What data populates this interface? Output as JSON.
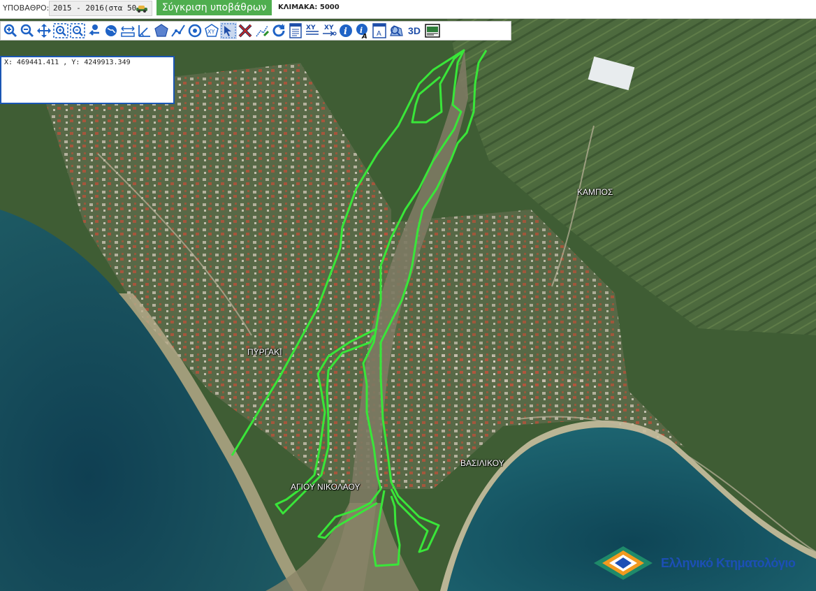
{
  "topbar": {
    "basemap_label": "ΥΠΟΒΑΘΡΟ:",
    "basemap_value": "2015 - 2016(στα 50",
    "compare_button": "Σύγκριση υποβάθρων",
    "scale_text": "ΚΛΙΜΑΚΑ: 5000"
  },
  "toolbar": {
    "tools": [
      {
        "icon": "zoom-in-icon"
      },
      {
        "icon": "zoom-out-icon"
      },
      {
        "icon": "pan-icon"
      },
      {
        "icon": "zoom-box-in-icon"
      },
      {
        "icon": "zoom-box-out-icon"
      },
      {
        "icon": "previous-extent-icon"
      },
      {
        "icon": "full-extent-globe-icon"
      },
      {
        "icon": "measure-distance-icon"
      },
      {
        "icon": "measure-angle-icon"
      },
      {
        "icon": "measure-area-icon"
      },
      {
        "icon": "draw-polyline-icon"
      },
      {
        "icon": "draw-circle-icon"
      },
      {
        "icon": "xy-polygon-icon"
      },
      {
        "icon": "select-arrow-icon"
      },
      {
        "icon": "clear-icon"
      },
      {
        "icon": "edit-line-icon"
      },
      {
        "icon": "refresh-icon"
      },
      {
        "icon": "document-icon"
      },
      {
        "icon": "xy-goto-icon"
      },
      {
        "icon": "xy-transform-icon"
      },
      {
        "icon": "info-icon"
      },
      {
        "icon": "info-text-icon"
      },
      {
        "icon": "label-icon"
      },
      {
        "icon": "polygon-search-icon"
      },
      {
        "icon": "3d-icon",
        "label": "3D"
      },
      {
        "icon": "print-map-icon"
      }
    ],
    "text_tool_label": "A"
  },
  "coords": {
    "text": "X: 469441.411 , Y: 4249913.349"
  },
  "map_labels": {
    "pyrgaki": "ΠΥΡΓΑΚΙ",
    "kampos": "ΚΑΜΠΟΣ",
    "vasilikou": "ΒΑΣΙΛΙΚΟΥ",
    "agiou_nikolaou": "ΑΓΙΟΥ ΝΙΚΟΛΑΟΥ"
  },
  "logo": {
    "text": "Ελληνικό Κτηματολόγιο"
  },
  "colors": {
    "accent_green": "#4fae4f",
    "outline_green": "#39e639",
    "logo_blue": "#1c4fb5",
    "logo_orange": "#f29a1f",
    "logo_teal": "#1f8a6a"
  }
}
